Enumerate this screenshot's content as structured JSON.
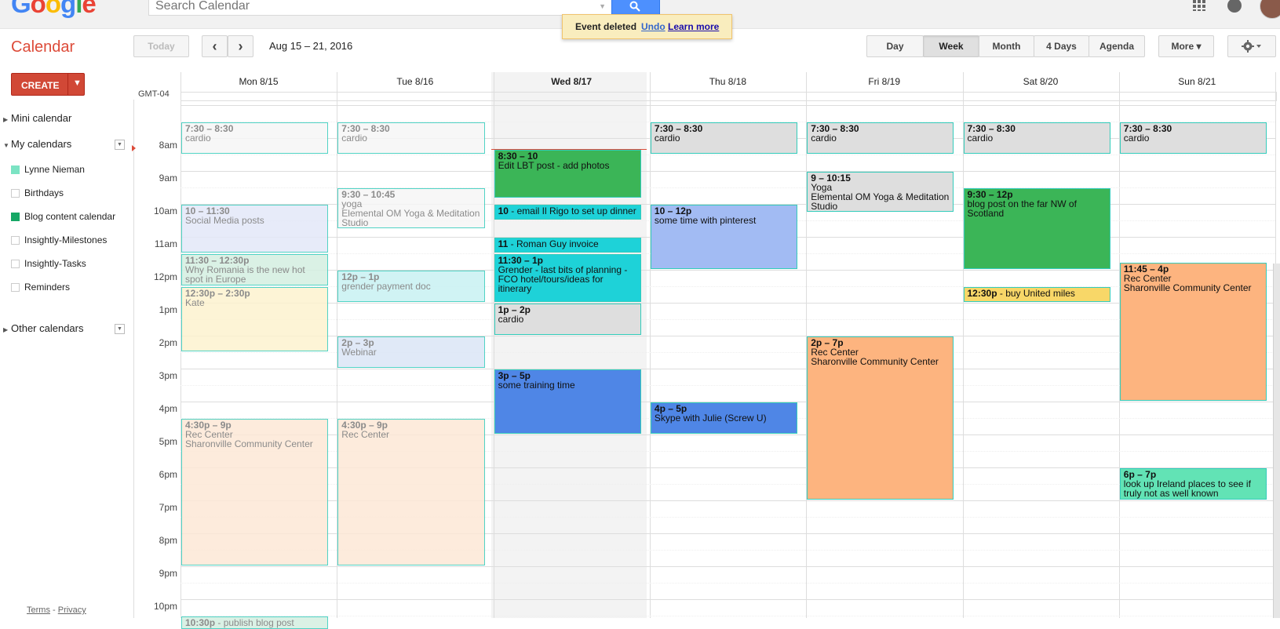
{
  "header": {
    "logo": [
      "G",
      "o",
      "o",
      "g",
      "l",
      "e"
    ],
    "search_placeholder": "Search Calendar",
    "toast": {
      "message": "Event deleted",
      "undo": "Undo",
      "learn": "Learn more"
    }
  },
  "app_title": "Calendar",
  "toolbar": {
    "today": "Today",
    "prev": "‹",
    "next": "›",
    "date_range": "Aug 15 – 21, 2016",
    "views": [
      "Day",
      "Week",
      "Month",
      "4 Days",
      "Agenda"
    ],
    "active_view": "Week",
    "more": "More ▾",
    "settings_icon": "gear-icon"
  },
  "create": {
    "label": "CREATE",
    "arrow": "▼"
  },
  "sidebar": {
    "mini_calendar": "Mini calendar",
    "my_calendars": "My calendars",
    "calendars": [
      {
        "name": "Lynne Nieman",
        "color": "#7be3c3",
        "checked": true
      },
      {
        "name": "Birthdays",
        "color": "",
        "checked": false
      },
      {
        "name": "Blog content calendar",
        "color": "#16a765",
        "checked": true
      },
      {
        "name": "Insightly-Milestones",
        "color": "",
        "checked": false
      },
      {
        "name": "Insightly-Tasks",
        "color": "",
        "checked": false
      },
      {
        "name": "Reminders",
        "color": "",
        "checked": false
      }
    ],
    "other_calendars": "Other calendars",
    "footer_terms": "Terms",
    "footer_sep": " - ",
    "footer_privacy": "Privacy"
  },
  "grid": {
    "timezone": "GMT-04",
    "days": [
      "Mon 8/15",
      "Tue 8/16",
      "Wed 8/17",
      "Thu 8/18",
      "Fri 8/19",
      "Sat 8/20",
      "Sun 8/21"
    ],
    "today_index": 2,
    "hours": [
      "8am",
      "9am",
      "10am",
      "11am",
      "12pm",
      "1pm",
      "2pm",
      "3pm",
      "4pm",
      "5pm",
      "6pm",
      "7pm",
      "8pm",
      "9pm",
      "10pm"
    ]
  },
  "events": [
    {
      "day": 0,
      "start": 7.5,
      "end": 8.5,
      "time": "7:30 – 8:30",
      "title": "cardio",
      "lines": [],
      "color": "#f6f6f6",
      "faded": true
    },
    {
      "day": 0,
      "start": 10,
      "end": 11.5,
      "time": "10 – 11:30",
      "title": "Social Media posts",
      "lines": [],
      "color": "#e3e8f8",
      "faded": true
    },
    {
      "day": 0,
      "start": 11.5,
      "end": 12.5,
      "time": "11:30 – 12:30p",
      "title": "Why Romania is the new hot spot in Europe",
      "lines": [],
      "color": "#d4efe1",
      "faded": true
    },
    {
      "day": 0,
      "start": 12.5,
      "end": 14.5,
      "time": "12:30p – 2:30p",
      "title": "Kate",
      "lines": [],
      "color": "#fdf3cf",
      "faded": true
    },
    {
      "day": 0,
      "start": 16.5,
      "end": 21,
      "time": "4:30p – 9p",
      "title": "Rec Center",
      "lines": [
        "Sharonville Community Center"
      ],
      "color": "#fde8d6",
      "faded": true
    },
    {
      "day": 0,
      "start": 22.5,
      "end": 23,
      "time": "10:30p",
      "title": "publish blog post",
      "lines": [],
      "color": "#d4efe1",
      "faded": true,
      "inline": true
    },
    {
      "day": 1,
      "start": 7.5,
      "end": 8.5,
      "time": "7:30 – 8:30",
      "title": "cardio",
      "lines": [],
      "color": "#f6f6f6",
      "faded": true
    },
    {
      "day": 1,
      "start": 9.5,
      "end": 10.75,
      "time": "9:30 – 10:45",
      "title": "yoga",
      "lines": [
        "Elemental OM Yoga & Meditation Studio"
      ],
      "color": "#f6f6f6",
      "faded": true
    },
    {
      "day": 1,
      "start": 12,
      "end": 13,
      "time": "12p – 1p",
      "title": "grender payment doc",
      "lines": [],
      "color": "#c8f1f3",
      "faded": true
    },
    {
      "day": 1,
      "start": 14,
      "end": 15,
      "time": "2p – 3p",
      "title": "Webinar",
      "lines": [],
      "color": "#dbe6f6",
      "faded": true
    },
    {
      "day": 1,
      "start": 16.5,
      "end": 21,
      "time": "4:30p – 9p",
      "title": "Rec Center",
      "lines": [],
      "color": "#fde8d6",
      "faded": true
    },
    {
      "day": 2,
      "start": 8.33,
      "end": 9.83,
      "time": "8:30 – 10",
      "title": "Edit LBT post - add photos",
      "lines": [],
      "color": "#3bb557",
      "faded": false
    },
    {
      "day": 2,
      "start": 10,
      "end": 10.5,
      "time": "10",
      "title": "email Il Rigo to set up dinner",
      "lines": [],
      "color": "#1ed2d8",
      "faded": false,
      "inline": true
    },
    {
      "day": 2,
      "start": 11,
      "end": 11.5,
      "time": "11",
      "title": "Roman Guy invoice",
      "lines": [],
      "color": "#1ed2d8",
      "faded": false,
      "inline": true
    },
    {
      "day": 2,
      "start": 11.5,
      "end": 13,
      "time": "11:30 – 1p",
      "title": "Grender - last bits of planning - FCO hotel/tours/ideas for itinerary",
      "lines": [],
      "color": "#1ed2d8",
      "faded": false
    },
    {
      "day": 2,
      "start": 13,
      "end": 14,
      "time": "1p – 2p",
      "title": "cardio",
      "lines": [],
      "color": "#dedede",
      "faded": false
    },
    {
      "day": 2,
      "start": 15,
      "end": 17,
      "time": "3p – 5p",
      "title": "some training time",
      "lines": [],
      "color": "#4f86e6",
      "faded": false
    },
    {
      "day": 3,
      "start": 7.5,
      "end": 8.5,
      "time": "7:30 – 8:30",
      "title": "cardio",
      "lines": [],
      "color": "#dedede",
      "faded": false
    },
    {
      "day": 3,
      "start": 10,
      "end": 12,
      "time": "10 – 12p",
      "title": "some time with pinterest",
      "lines": [],
      "color": "#a2bbf3",
      "faded": false
    },
    {
      "day": 3,
      "start": 16,
      "end": 17,
      "time": "4p – 5p",
      "title": "Skype with Julie (Screw U)",
      "lines": [],
      "color": "#4f86e6",
      "faded": false
    },
    {
      "day": 4,
      "start": 7.5,
      "end": 8.5,
      "time": "7:30 – 8:30",
      "title": "cardio",
      "lines": [],
      "color": "#dedede",
      "faded": false
    },
    {
      "day": 4,
      "start": 9,
      "end": 10.25,
      "time": "9 – 10:15",
      "title": "Yoga",
      "lines": [
        "Elemental OM Yoga & Meditation Studio"
      ],
      "color": "#dedede",
      "faded": false
    },
    {
      "day": 4,
      "start": 14,
      "end": 19,
      "time": "2p – 7p",
      "title": "Rec Center",
      "lines": [
        "Sharonville Community Center"
      ],
      "color": "#fdb47f",
      "faded": false
    },
    {
      "day": 5,
      "start": 7.5,
      "end": 8.5,
      "time": "7:30 – 8:30",
      "title": "cardio",
      "lines": [],
      "color": "#dedede",
      "faded": false
    },
    {
      "day": 5,
      "start": 9.5,
      "end": 12,
      "time": "9:30 – 12p",
      "title": "blog post on the far NW of Scotland",
      "lines": [],
      "color": "#3bb557",
      "faded": false
    },
    {
      "day": 5,
      "start": 12.5,
      "end": 13,
      "time": "12:30p",
      "title": "buy United miles",
      "lines": [],
      "color": "#f8d768",
      "faded": false,
      "inline": true
    },
    {
      "day": 6,
      "start": 7.5,
      "end": 8.5,
      "time": "7:30 – 8:30",
      "title": "cardio",
      "lines": [],
      "color": "#dedede",
      "faded": false
    },
    {
      "day": 6,
      "start": 11.75,
      "end": 16,
      "time": "11:45 – 4p",
      "title": "Rec Center",
      "lines": [
        "Sharonville Community Center"
      ],
      "color": "#fdb47f",
      "faded": false
    },
    {
      "day": 6,
      "start": 18,
      "end": 19,
      "time": "6p – 7p",
      "title": "look up Ireland places to see if truly not as well known",
      "lines": [],
      "color": "#62e3b5",
      "faded": false
    }
  ]
}
